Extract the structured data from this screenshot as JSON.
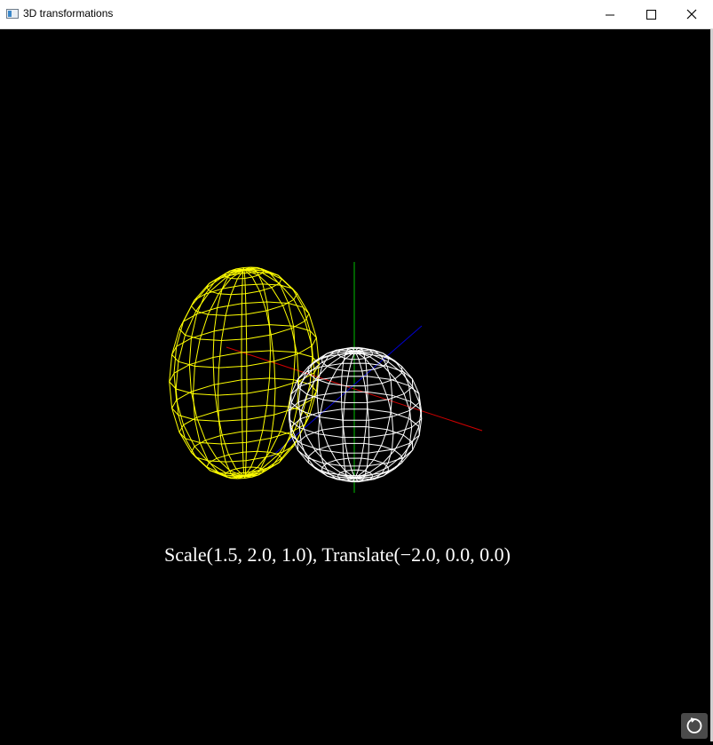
{
  "window": {
    "title": "3D transformations"
  },
  "scene": {
    "caption": "Scale(1.5, 2.0, 1.0), Translate(−2.0, 0.0, 0.0)",
    "axes": {
      "x_color": "#d00000",
      "y_color": "#00c000",
      "z_color": "#0000d0"
    },
    "transformed_sphere_color": "#ffff00",
    "original_sphere_color": "#ffffff",
    "background": "#000000"
  },
  "icons": {
    "app": "app-window-icon",
    "minimize": "minimize-icon",
    "maximize": "maximize-icon",
    "close": "close-icon",
    "reset": "refresh-icon"
  }
}
